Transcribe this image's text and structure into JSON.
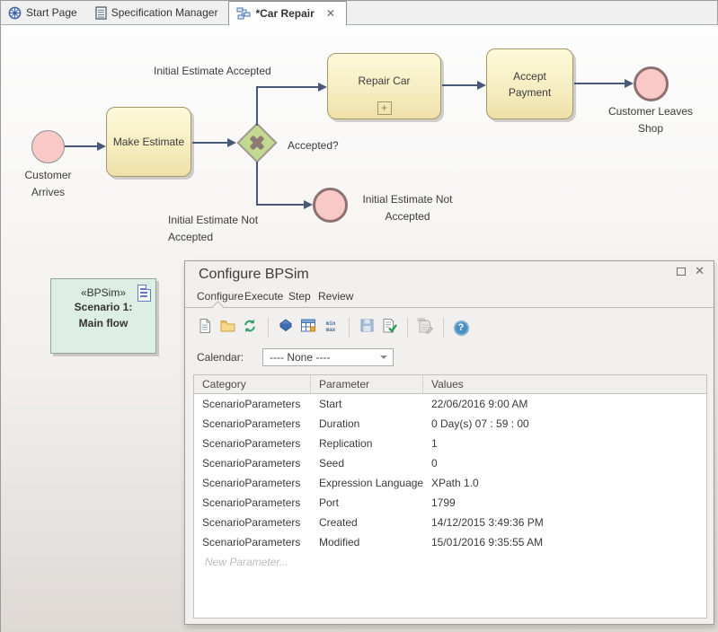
{
  "window": {
    "tabs": [
      {
        "label": "Start Page"
      },
      {
        "label": "Specification Manager"
      },
      {
        "label": "*Car Repair"
      }
    ],
    "tab_close_glyph": "✕"
  },
  "diagram": {
    "start_event_label": "Customer\nArrives",
    "task_make_estimate": "Make Estimate",
    "task_repair_car": "Repair Car",
    "task_accept_payment": "Accept\nPayment",
    "subprocess_marker": "+",
    "gateway_label": "Accepted?",
    "flow_accepted_label": "Initial Estimate Accepted",
    "flow_not_accepted_label": "Initial Estimate Not\nAccepted",
    "end_not_accepted_label": "Initial Estimate Not\nAccepted",
    "end_customer_leaves_label": "Customer Leaves\nShop"
  },
  "artifact": {
    "stereotype": "«BPSim»",
    "name": "Scenario 1:\nMain flow"
  },
  "dialog": {
    "title": "Configure BPSim",
    "max_glyph": "",
    "close_glyph": "✕",
    "tabs": [
      "Configure",
      "Execute",
      "Step",
      "Review"
    ],
    "toolbar": {
      "minmax_text": "min\nmax",
      "xml_badge": "XML",
      "help_glyph": "?"
    },
    "calendar_label": "Calendar:",
    "calendar_value": "---- None ----",
    "table": {
      "columns": [
        "Category",
        "Parameter",
        "Values"
      ],
      "rows": [
        [
          "ScenarioParameters",
          "Start",
          "22/06/2016 9:00 AM"
        ],
        [
          "ScenarioParameters",
          "Duration",
          "0 Day(s) 07 : 59 : 00"
        ],
        [
          "ScenarioParameters",
          "Replication",
          "1"
        ],
        [
          "ScenarioParameters",
          "Seed",
          "0"
        ],
        [
          "ScenarioParameters",
          "Expression Language",
          "XPath 1.0"
        ],
        [
          "ScenarioParameters",
          "Port",
          "1799"
        ],
        [
          "ScenarioParameters",
          "Created",
          "14/12/2015 3:49:36 PM"
        ],
        [
          "ScenarioParameters",
          "Modified",
          "15/01/2016 9:35:55 AM"
        ]
      ],
      "placeholder_row": "New Parameter..."
    }
  },
  "colors": {
    "task_fill_top": "#fdf9da",
    "task_fill_bottom": "#eee0a8",
    "task_border": "#a39768",
    "event_fill": "#f9c9c7",
    "end_event_border": "#8d7171",
    "gateway_fill": "#c2da90",
    "gateway_cross": "#8b7a72",
    "connector": "#4a5878",
    "artifact_fill": "#ddeee4",
    "canvas_bottom": "#ded9d5"
  }
}
